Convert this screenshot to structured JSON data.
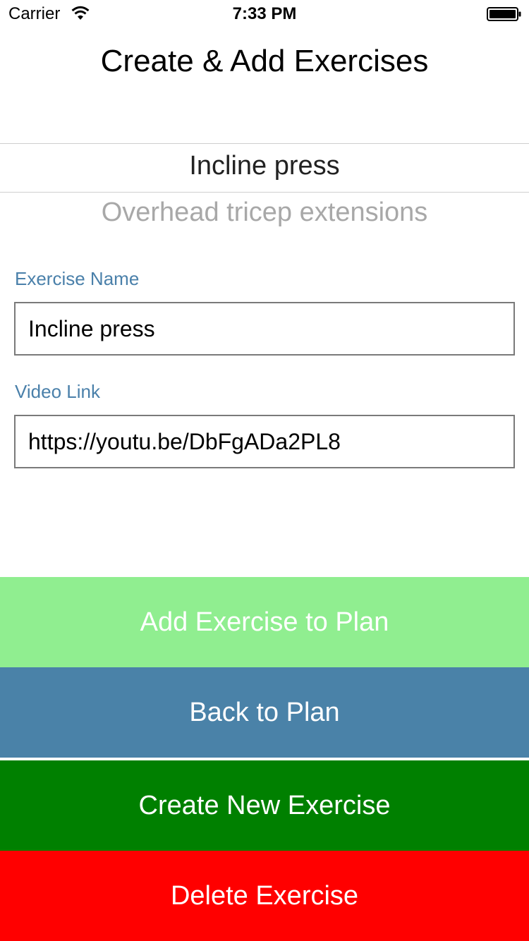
{
  "status_bar": {
    "carrier": "Carrier",
    "time": "7:33 PM",
    "wifi_icon": "wifi-icon",
    "battery_icon": "battery-icon"
  },
  "header": {
    "title": "Create & Add Exercises"
  },
  "picker": {
    "selected": "Incline press",
    "next": "Overhead tricep extensions"
  },
  "form": {
    "exercise_name_label": "Exercise Name",
    "exercise_name_value": "Incline press",
    "video_link_label": "Video Link",
    "video_link_value": "https://youtu.be/DbFgADa2PL8"
  },
  "buttons": {
    "add_to_plan": {
      "label": "Add Exercise to Plan",
      "color": "#90ee90"
    },
    "back_to_plan": {
      "label": "Back to Plan",
      "color": "#4a82a8"
    },
    "create_new": {
      "label": "Create New Exercise",
      "color": "#008000"
    },
    "delete": {
      "label": "Delete Exercise",
      "color": "#ff0000"
    }
  }
}
